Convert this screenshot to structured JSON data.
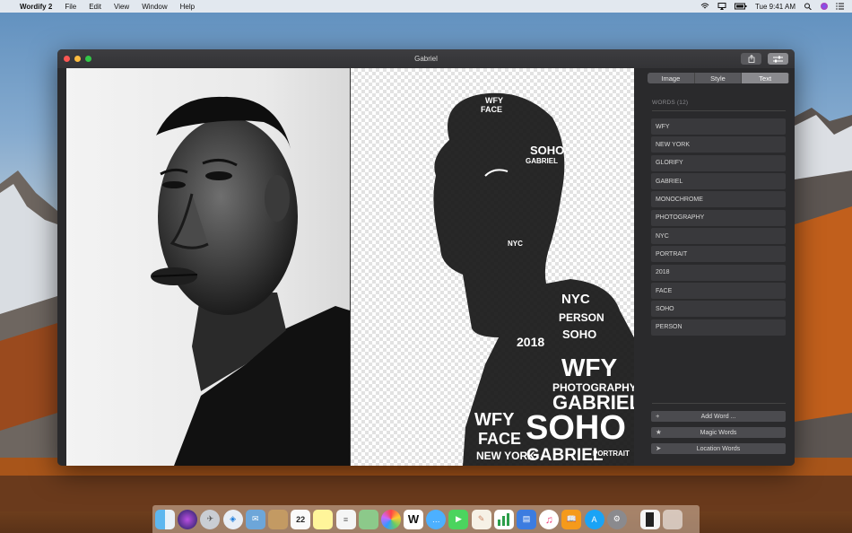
{
  "menubar": {
    "app_name": "Wordify 2",
    "items": [
      "File",
      "Edit",
      "View",
      "Window",
      "Help"
    ],
    "clock": "Tue 9:41 AM"
  },
  "window": {
    "title": "Gabriel"
  },
  "panel": {
    "tabs": [
      {
        "label": "Image",
        "active": false
      },
      {
        "label": "Style",
        "active": false
      },
      {
        "label": "Text",
        "active": true
      }
    ],
    "words_header": "WORDS (12)",
    "words": [
      "WFY",
      "NEW YORK",
      "GLORIFY",
      "GABRIEL",
      "MONOCHROME",
      "PHOTOGRAPHY",
      "NYC",
      "PORTRAIT",
      "2018",
      "FACE",
      "SOHO",
      "PERSON"
    ],
    "add_word_label": "Add Word ...",
    "magic_words_label": "Magic Words",
    "location_words_label": "Location Words"
  },
  "dock": {
    "icons": [
      "finder-icon",
      "siri-icon",
      "launchpad-icon",
      "safari-icon",
      "mail-icon",
      "contacts-icon",
      "calendar-icon",
      "notes-icon",
      "reminders-icon",
      "maps-icon",
      "photos-icon",
      "wordify-icon",
      "messages-icon",
      "facetime-icon",
      "pages-icon",
      "numbers-icon",
      "keynote-icon",
      "itunes-icon",
      "ibooks-icon",
      "appstore-icon",
      "preferences-icon",
      "document-icon",
      "trash-icon"
    ],
    "calendar_day": "22"
  },
  "colors": {
    "window_bg": "#2a2a2c",
    "row_bg": "#39393c",
    "close": "#fc5753",
    "minimize": "#fdbc40",
    "zoom": "#33c748"
  }
}
